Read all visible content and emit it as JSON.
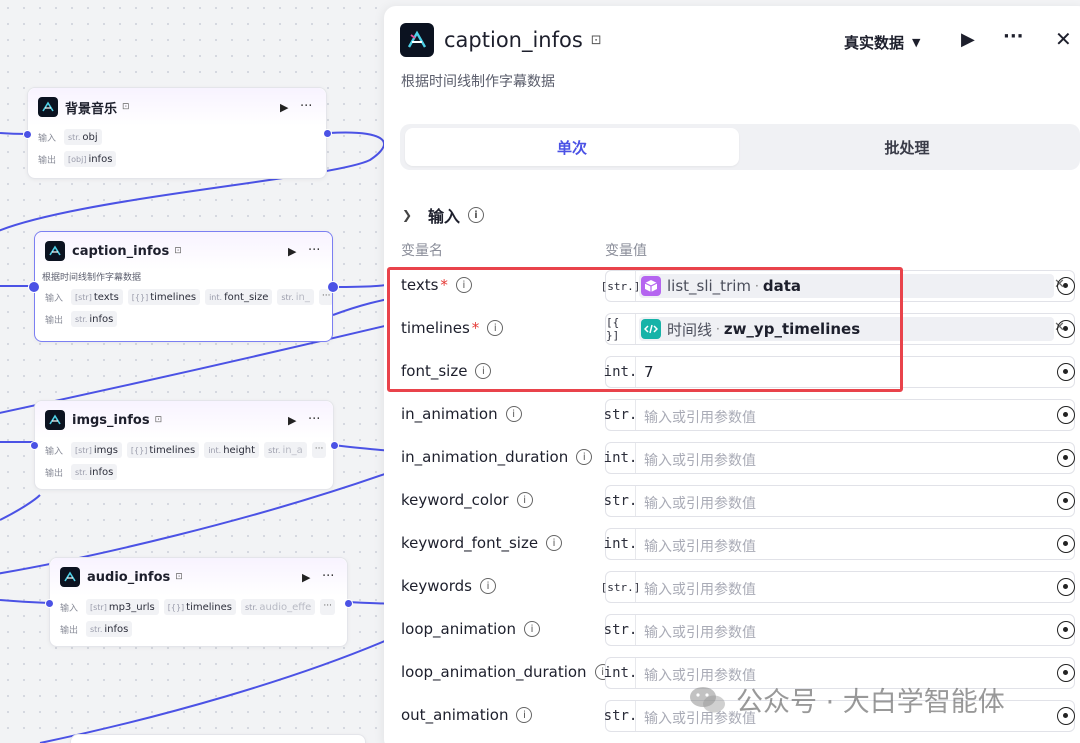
{
  "canvas": {
    "nodes": [
      {
        "id": "bgmusic",
        "title": "背景音乐",
        "tag": "⊡",
        "inputs_label": "输入",
        "outputs_label": "输出",
        "inputs": [
          {
            "type": "str.",
            "name": "obj"
          }
        ],
        "outputs": [
          {
            "type": "[obj]",
            "name": "infos"
          }
        ]
      },
      {
        "id": "caption",
        "title": "caption_infos",
        "tag": "⊡",
        "desc": "根据时间线制作字幕数据",
        "inputs_label": "输入",
        "outputs_label": "输出",
        "inputs": [
          {
            "type": "[str]",
            "name": "texts"
          },
          {
            "type": "[{}]",
            "name": "timelines"
          },
          {
            "type": "int.",
            "name": "font_size"
          },
          {
            "type": "str.",
            "name": "in_"
          }
        ],
        "outputs": [
          {
            "type": "str.",
            "name": "infos"
          }
        ]
      },
      {
        "id": "imgs",
        "title": "imgs_infos",
        "tag": "⊡",
        "inputs_label": "输入",
        "outputs_label": "输出",
        "inputs": [
          {
            "type": "[str]",
            "name": "imgs"
          },
          {
            "type": "[{}]",
            "name": "timelines"
          },
          {
            "type": "int.",
            "name": "height"
          },
          {
            "type": "str.",
            "name": "in_a"
          }
        ],
        "outputs": [
          {
            "type": "str.",
            "name": "infos"
          }
        ]
      },
      {
        "id": "audio",
        "title": "audio_infos",
        "tag": "⊡",
        "inputs_label": "输入",
        "outputs_label": "输出",
        "inputs": [
          {
            "type": "[str]",
            "name": "mp3_urls"
          },
          {
            "type": "[{}]",
            "name": "timelines"
          },
          {
            "type": "str.",
            "name": "audio_effe"
          }
        ],
        "outputs": [
          {
            "type": "str.",
            "name": "infos"
          }
        ]
      }
    ],
    "more_label": "···",
    "run_label": "▶"
  },
  "panel": {
    "title": "caption_infos",
    "tag": "⊡",
    "description": "根据时间线制作字幕数据",
    "data_mode": "真实数据",
    "tabs": [
      "单次",
      "批处理"
    ],
    "section_title": "输入",
    "col_name": "变量名",
    "col_value": "变量值",
    "params": [
      {
        "name": "texts",
        "required": true,
        "type": "[str.]",
        "ref": {
          "source": "list_sli_trim",
          "key": "data",
          "icon": "cube-icon",
          "color": "#b565f0"
        }
      },
      {
        "name": "timelines",
        "required": true,
        "type": "[{ }]",
        "ref": {
          "source": "时间线",
          "key": "zw_yp_timelines",
          "icon": "code-icon",
          "color": "#16b3a8"
        }
      },
      {
        "name": "font_size",
        "required": false,
        "type": "int.",
        "value": "7"
      },
      {
        "name": "in_animation",
        "required": false,
        "type": "str.",
        "placeholder": "输入或引用参数值"
      },
      {
        "name": "in_animation_duration",
        "required": false,
        "type": "int.",
        "placeholder": "输入或引用参数值"
      },
      {
        "name": "keyword_color",
        "required": false,
        "type": "str.",
        "placeholder": "输入或引用参数值"
      },
      {
        "name": "keyword_font_size",
        "required": false,
        "type": "int.",
        "placeholder": "输入或引用参数值"
      },
      {
        "name": "keywords",
        "required": false,
        "type": "[str.]",
        "placeholder": "输入或引用参数值"
      },
      {
        "name": "loop_animation",
        "required": false,
        "type": "str.",
        "placeholder": "输入或引用参数值"
      },
      {
        "name": "loop_animation_duration",
        "required": false,
        "type": "int.",
        "placeholder": "输入或引用参数值"
      },
      {
        "name": "out_animation",
        "required": false,
        "type": "str.",
        "placeholder": "输入或引用参数值"
      }
    ]
  },
  "watermark": "公众号 · 大白学智能体",
  "colors": {
    "accent": "#4b52e5",
    "highlight": "#e9434b",
    "wire": "#4b52e5"
  }
}
